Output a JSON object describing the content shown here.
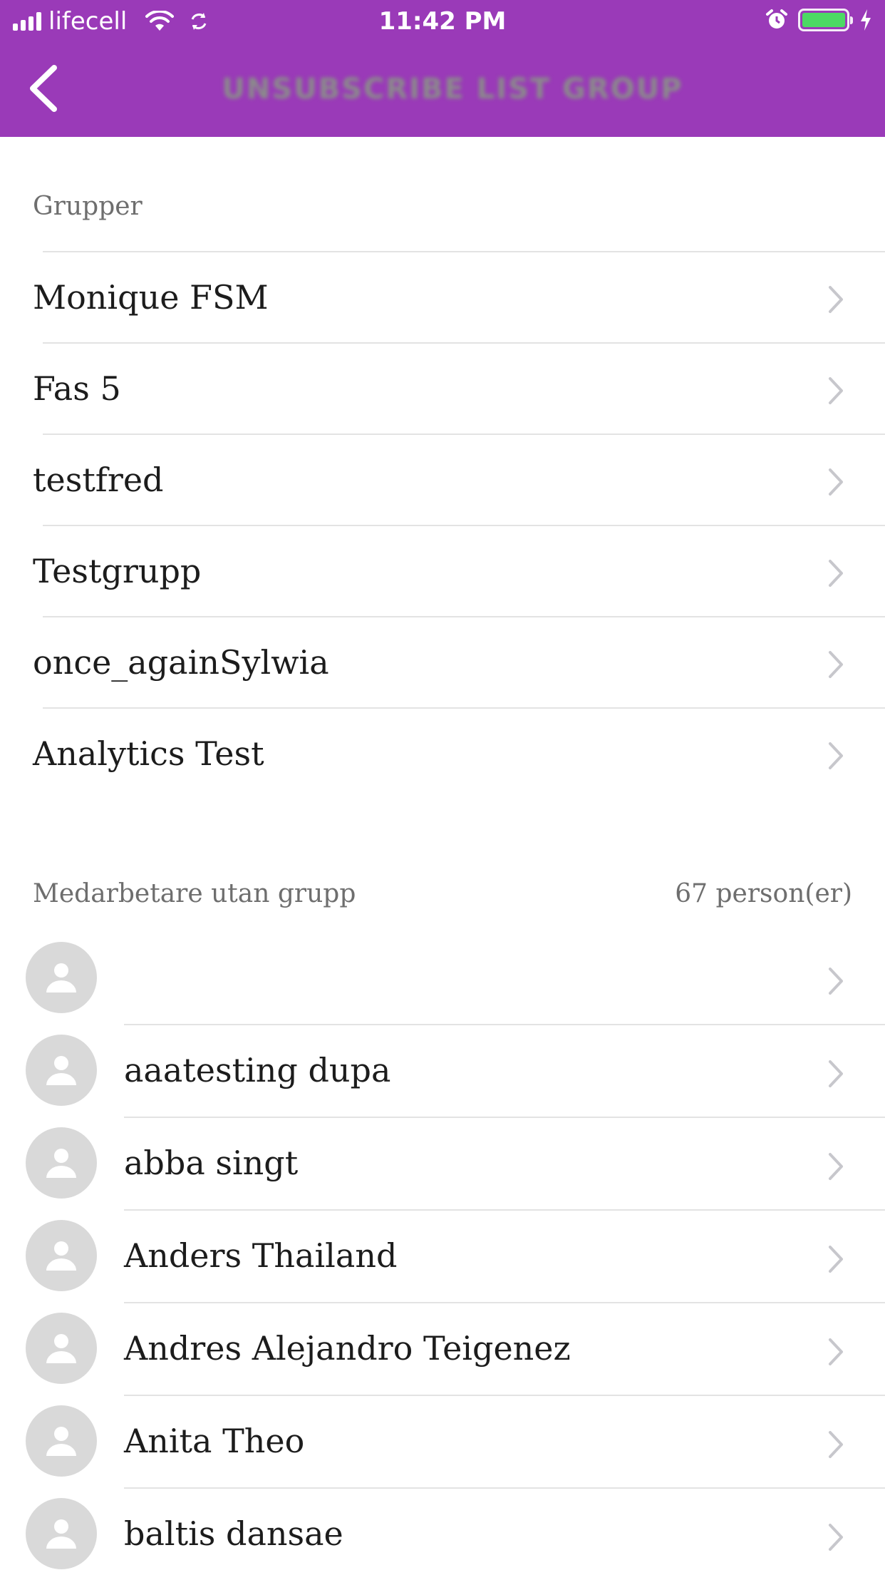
{
  "status_bar": {
    "carrier": "lifecell",
    "time": "11:42 PM",
    "battery_color": "#4cd964"
  },
  "header": {
    "background": "#9a3ab8",
    "title": "UNSUBSCRIBE LIST GROUP",
    "back_icon": "chevron-left-icon",
    "dropdown_icon": "chevron-down-icon"
  },
  "groups": {
    "header": "Grupper",
    "items": [
      {
        "label": "Monique FSM"
      },
      {
        "label": "Fas 5"
      },
      {
        "label": "testfred"
      },
      {
        "label": "Testgrupp"
      },
      {
        "label": "once_againSylwia"
      },
      {
        "label": "Analytics Test"
      }
    ]
  },
  "people": {
    "header": "Medarbetare utan grupp",
    "count": "67 person(er)",
    "items": [
      {
        "name": ""
      },
      {
        "name": "aaatesting dupa"
      },
      {
        "name": "abba singt"
      },
      {
        "name": "Anders Thailand"
      },
      {
        "name": "Andres Alejandro Teigenez"
      },
      {
        "name": "Anita Theo"
      },
      {
        "name": "baltis dansae"
      }
    ]
  }
}
